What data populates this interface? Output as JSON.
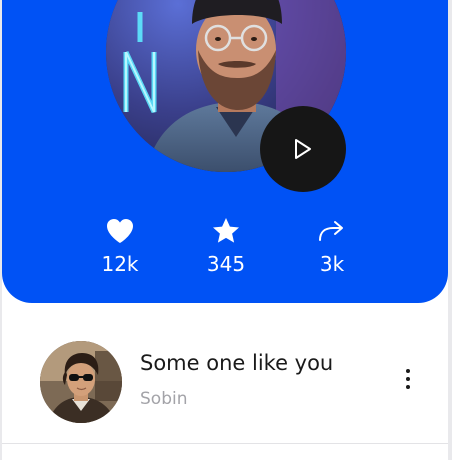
{
  "hero": {
    "background_color": "#0052f5",
    "album_art": "bearded-man-neon-portrait",
    "play_icon": "play-icon"
  },
  "stats": {
    "likes": {
      "icon": "heart-icon",
      "value": "12k"
    },
    "stars": {
      "icon": "star-icon",
      "value": "345"
    },
    "shares": {
      "icon": "share-icon",
      "value": "3k"
    }
  },
  "track": {
    "title": "Some one like you",
    "artist": "Sobin",
    "avatar": "man-with-sunglasses-portrait",
    "menu_icon": "more-vertical-icon"
  },
  "colors": {
    "accent": "#0052f5",
    "play_button": "#161616",
    "secondary_text": "#a3a3a8"
  }
}
